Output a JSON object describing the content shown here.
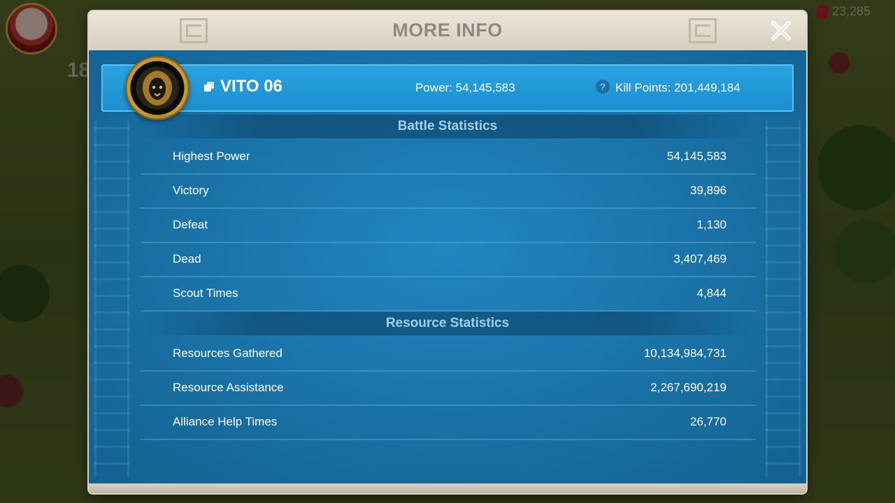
{
  "background": {
    "level_badge": "18",
    "gems": "23,285"
  },
  "modal": {
    "title": "MORE INFO",
    "player": {
      "name": "VITO 06",
      "power_text": "Power: 54,145,583",
      "kill_points_text": "Kill Points: 201,449,184"
    },
    "battle_section": {
      "title": "Battle Statistics",
      "rows": [
        {
          "label": "Highest Power",
          "value": "54,145,583"
        },
        {
          "label": "Victory",
          "value": "39,896"
        },
        {
          "label": "Defeat",
          "value": "1,130"
        },
        {
          "label": "Dead",
          "value": "3,407,469"
        },
        {
          "label": "Scout Times",
          "value": "4,844"
        }
      ]
    },
    "resource_section": {
      "title": "Resource Statistics",
      "rows": [
        {
          "label": "Resources Gathered",
          "value": "10,134,984,731"
        },
        {
          "label": "Resource Assistance",
          "value": "2,267,690,219"
        },
        {
          "label": "Alliance Help Times",
          "value": "26,770"
        }
      ]
    }
  },
  "colors": {
    "panel_blue": "#1c6fa4",
    "banner_blue": "#2aa3e0",
    "header_text": "#8f8a80",
    "section_text": "#9fd0ee"
  },
  "icons": {
    "close": "close-icon",
    "copy": "copy-icon",
    "help": "help-icon",
    "avatar": "lion-avatar",
    "gem": "gem-icon"
  }
}
